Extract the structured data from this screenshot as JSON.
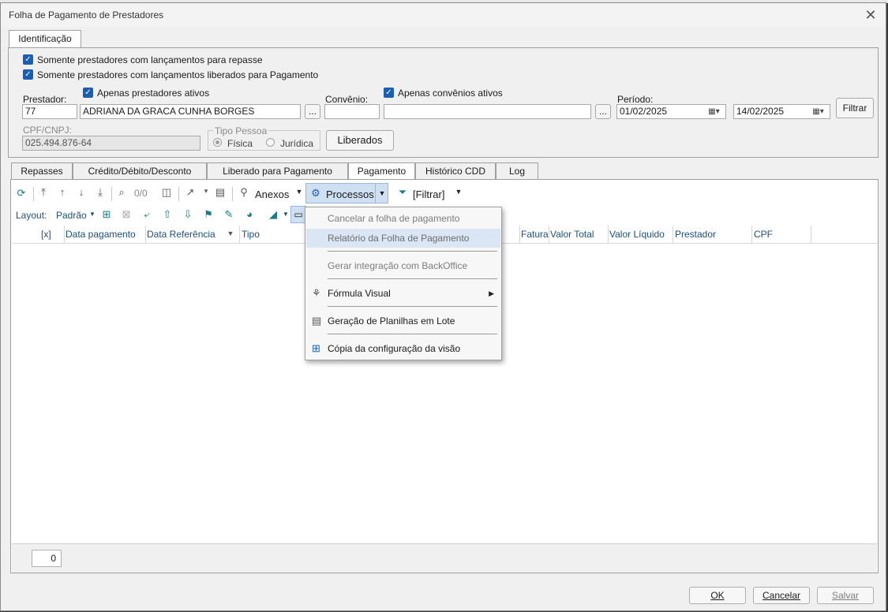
{
  "window": {
    "title": "Folha de Pagamento de Prestadores"
  },
  "top_tab": "Identificação",
  "ident": {
    "chk_repasse": "Somente prestadores com lançamentos para repasse",
    "chk_liberados": "Somente prestadores com lançamentos liberados para Pagamento",
    "prestador_label": "Prestador:",
    "chk_apenas_prestadores": "Apenas prestadores ativos",
    "prestador_code": "77",
    "prestador_name": "ADRIANA DA GRACA CUNHA BORGES",
    "ellipsis": "...",
    "convenio_label": "Convênio:",
    "chk_apenas_convenios": "Apenas convênios ativos",
    "convenio_code": "",
    "convenio_name": "",
    "periodo_label": "Período:",
    "date_from": "01/02/2025",
    "date_to": "14/02/2025",
    "filtrar_button": "Filtrar",
    "cpf_label": "CPF/CNPJ:",
    "cpf_value": "025.494.876-64",
    "tipo_pessoa_label": "Tipo Pessoa",
    "radio_fisica": "Física",
    "radio_juridica": "Jurídica",
    "liberados_button": "Liberados"
  },
  "tabs": [
    "Repasses",
    "Crédito/Débito/Desconto",
    "Liberado para Pagamento",
    "Pagamento",
    "Histórico CDD",
    "Log"
  ],
  "active_tab": "Pagamento",
  "toolbar": {
    "counter": "0/0",
    "anexos": "Anexos",
    "processos": "Processos",
    "filtrar": "[Filtrar]",
    "layout_label": "Layout:",
    "layout_value": "Padrão"
  },
  "grid": {
    "columns": [
      "[x]",
      "Data pagamento",
      "Data Referência",
      "Tipo",
      "Fatura",
      "Valor Total",
      "Valor Líquido",
      "Prestador",
      "CPF"
    ]
  },
  "footer": {
    "count": "0"
  },
  "menu": {
    "items": [
      {
        "label": "Cancelar a folha de pagamento",
        "state": "disabled"
      },
      {
        "label": "Relatório da Folha de Pagamento",
        "state": "highlighted"
      },
      {
        "label": "Gerar integração com BackOffice",
        "state": "disabled"
      },
      {
        "label": "Fórmula Visual",
        "state": "normal",
        "icon": "formula-visual-icon",
        "submenu": true
      },
      {
        "label": "Geração de Planilhas em Lote",
        "state": "normal",
        "icon": "spreadsheet-icon"
      },
      {
        "label": "Cópia da configuração da visão",
        "state": "normal",
        "icon": "copy-config-icon"
      }
    ]
  },
  "buttons": {
    "ok": "OK",
    "cancelar": "Cancelar",
    "salvar": "Salvar"
  }
}
